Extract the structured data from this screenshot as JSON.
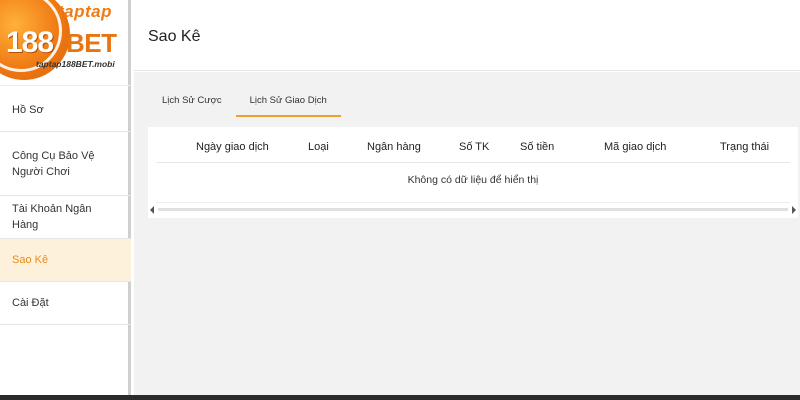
{
  "brand": {
    "top_text": "taptap",
    "number_text": "188",
    "bet_text": "BET",
    "url_text": "taptap188BET.mobi",
    "accent_color": "#f07a14"
  },
  "sidebar": {
    "items": [
      {
        "label": "Hồ Sơ",
        "active": false
      },
      {
        "label": "Công Cụ Bảo Vệ Người Chơi",
        "active": false
      },
      {
        "label": "Tài Khoản Ngân Hàng",
        "active": false
      },
      {
        "label": "Sao Kê",
        "active": true
      },
      {
        "label": "Cài Đặt",
        "active": false
      }
    ]
  },
  "header": {
    "title": "Sao Kê"
  },
  "tabs": [
    {
      "label": "Lịch Sử Cược",
      "active": false
    },
    {
      "label": "Lịch Sử Giao Dịch",
      "active": true
    }
  ],
  "table": {
    "columns": [
      "Ngày giao dịch",
      "Loại",
      "Ngân hàng",
      "Số TK",
      "Số tiền",
      "Mã giao dịch",
      "Trạng thái"
    ],
    "empty_message": "Không có dữ liệu để hiển thị"
  },
  "icons": {
    "scroll_left": "scroll-left-icon",
    "scroll_right": "scroll-right-icon"
  }
}
